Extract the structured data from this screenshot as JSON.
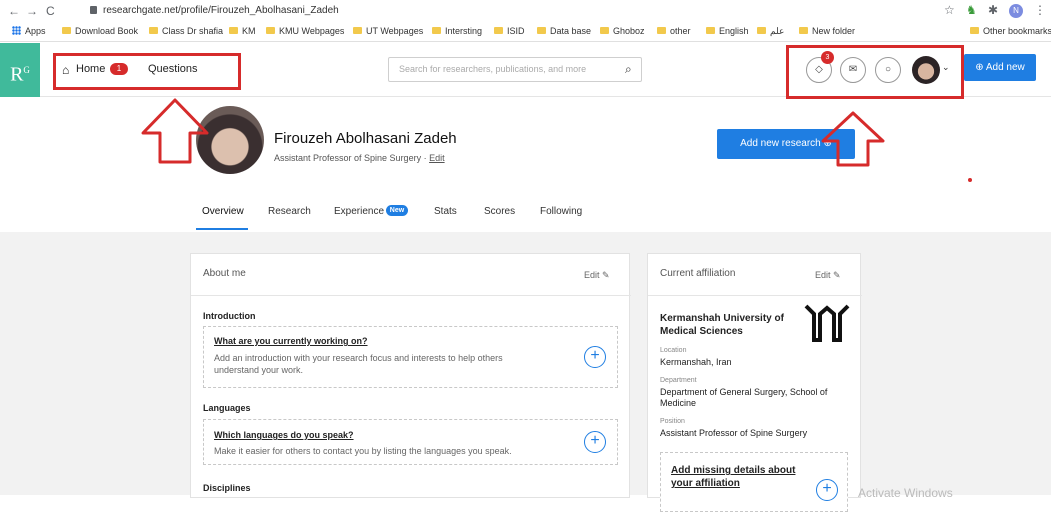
{
  "browser": {
    "url": "researchgate.net/profile/Firouzeh_Abolhasani_Zadeh",
    "profile_initial": "N"
  },
  "bookmarks": {
    "items": [
      "Apps",
      "Download Book",
      "Class Dr shafia",
      "KM",
      "KMU Webpages",
      "UT Webpages",
      "Intersting",
      "ISID",
      "Data base",
      "Ghoboz",
      "other",
      "English",
      "علم",
      "New folder"
    ],
    "other": "Other bookmarks"
  },
  "header": {
    "logo": "R",
    "logo_sup": "G",
    "home_label": "Home",
    "home_badge": "1",
    "questions_label": "Questions",
    "search_placeholder": "Search for researchers, publications, and more",
    "notification_badge": "3",
    "add_new_label": "Add new"
  },
  "profile": {
    "name": "Firouzeh Abolhasani Zadeh",
    "title": "Assistant Professor of Spine Surgery · ",
    "edit_link": "Edit",
    "add_research_label": "Add new research"
  },
  "tabs": {
    "overview": "Overview",
    "research": "Research",
    "experience": "Experience",
    "experience_badge": "New",
    "stats": "Stats",
    "scores": "Scores",
    "following": "Following"
  },
  "about": {
    "heading": "About me",
    "edit": "Edit",
    "introduction_title": "Introduction",
    "intro_prompt": "What are you currently working on?",
    "intro_desc": "Add an introduction with your research focus and interests to help others understand your work.",
    "languages_title": "Languages",
    "lang_prompt": "Which languages do you speak?",
    "lang_desc": "Make it easier for others to contact you by listing the languages you speak.",
    "disciplines_title": "Disciplines"
  },
  "affiliation": {
    "heading": "Current affiliation",
    "edit": "Edit",
    "institution": "Kermanshah University of Medical Sciences",
    "location_label": "Location",
    "location": "Kermanshah, Iran",
    "department_label": "Department",
    "department": "Department of General Surgery, School of Medicine",
    "position_label": "Position",
    "position": "Assistant Professor of Spine Surgery",
    "missing_prompt": "Add missing details about your affiliation"
  },
  "watermark": "Activate Windows",
  "colors": {
    "brand": "#40ba9b",
    "primary": "#1f7ee2",
    "annotation": "#d62b2b"
  }
}
